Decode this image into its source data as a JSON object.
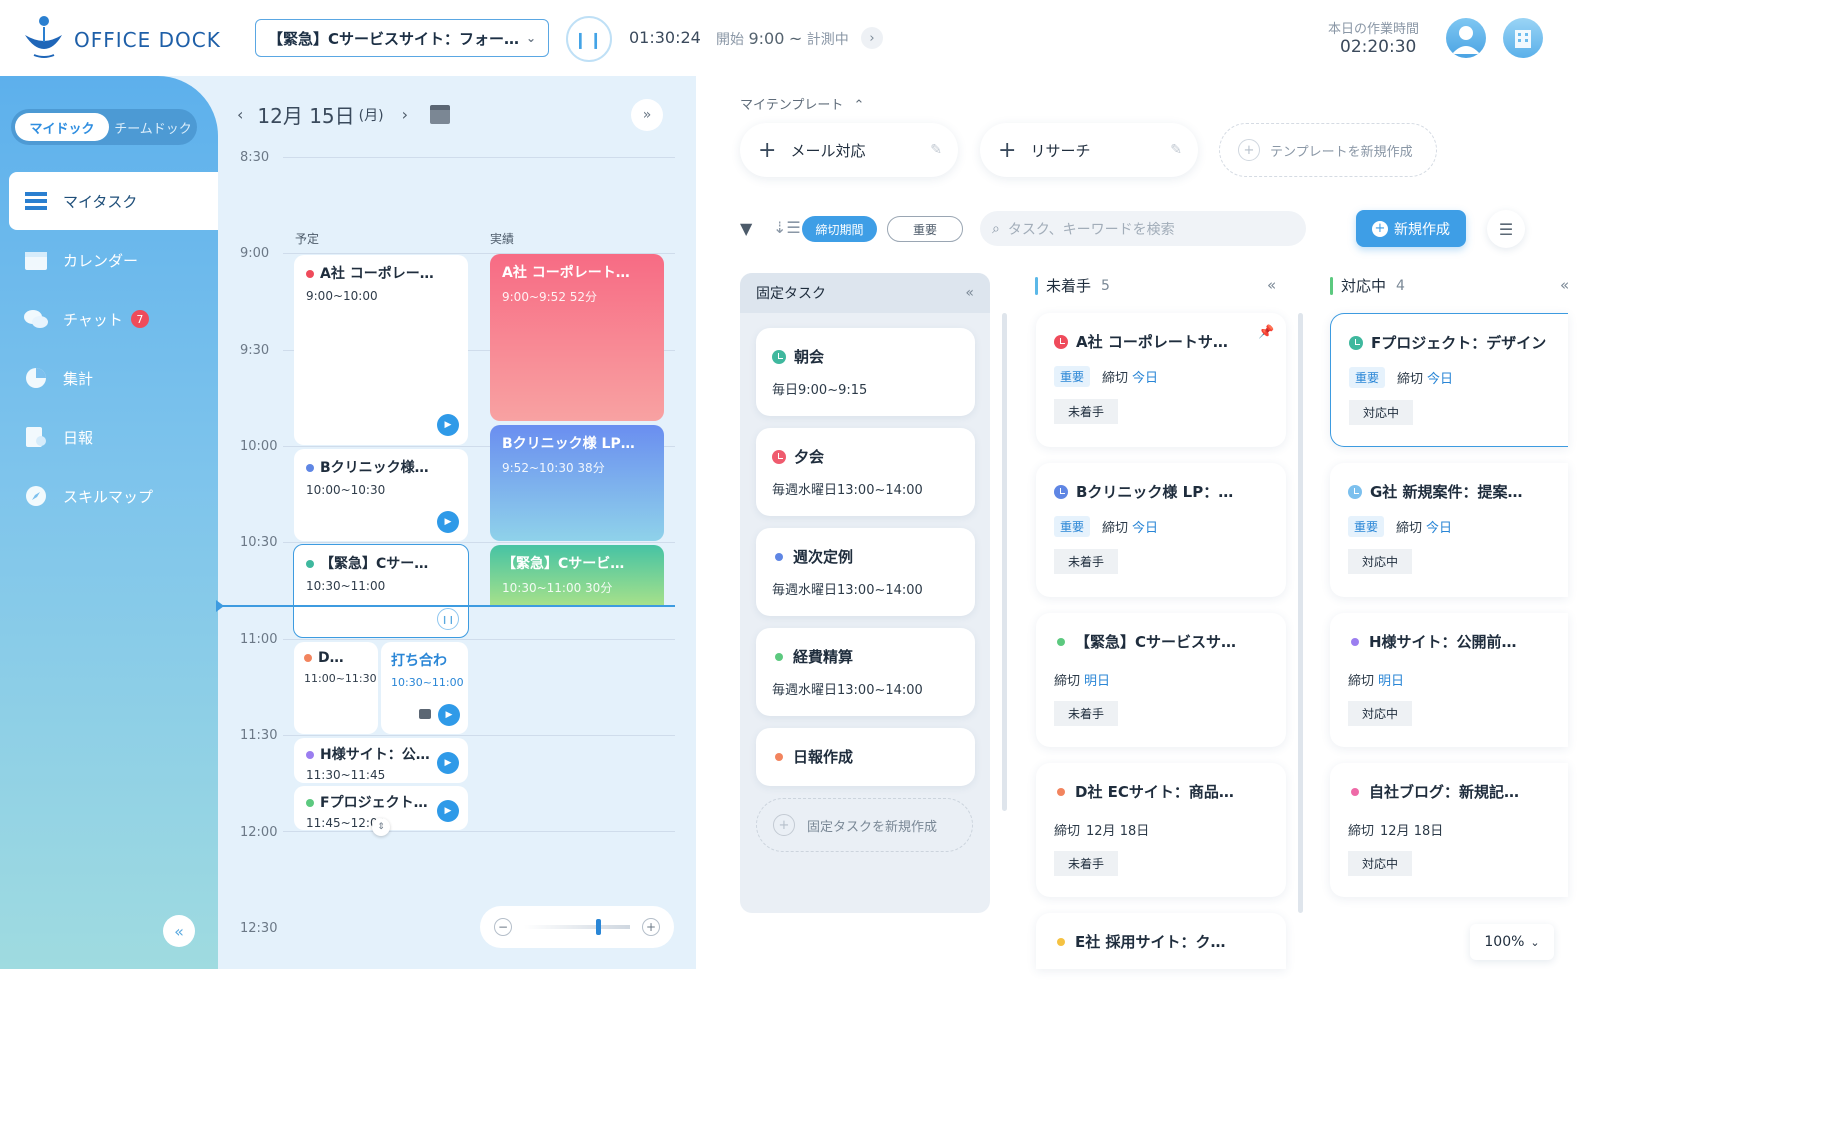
{
  "header": {
    "logo": "OFFICE DOCK",
    "current_task": "【緊急】Cサービスサイト：フォー…",
    "timer": "01:30:24",
    "start_label": "開始",
    "start_time": "9:00",
    "tilde": "~",
    "measuring": "計測中",
    "worktime_label": "本日の作業時間",
    "worktime": "02:20:30"
  },
  "sidebar": {
    "toggle_on": "マイドック",
    "toggle_off": "チームドック",
    "items": [
      {
        "label": "マイタスク",
        "icon": "list-icon"
      },
      {
        "label": "カレンダー",
        "icon": "calendar-icon"
      },
      {
        "label": "チャット",
        "icon": "chat-icon",
        "badge": "7"
      },
      {
        "label": "集計",
        "icon": "pie-chart-icon"
      },
      {
        "label": "日報",
        "icon": "report-icon"
      },
      {
        "label": "スキルマップ",
        "icon": "compass-icon"
      }
    ]
  },
  "calendar": {
    "date": "12月 15日",
    "weekday": "(月)",
    "col_plan": "予定",
    "col_actual": "実績",
    "times": [
      "8:30",
      "9:00",
      "9:30",
      "10:00",
      "10:30",
      "11:00",
      "11:30",
      "12:00",
      "12:30"
    ],
    "plans": [
      {
        "title": "A社 コーポレー…",
        "time": "9:00~10:00",
        "color": "#ef4b5b"
      },
      {
        "title": "Bクリニック様…",
        "time": "10:00~10:30",
        "color": "#5f86e4"
      },
      {
        "title": "【緊急】Cサー…",
        "time": "10:30~11:00",
        "color": "#3fb89e"
      },
      {
        "title": "D…",
        "time": "11:00~11:30",
        "color": "#f2845e"
      },
      {
        "title": "打ち合わ",
        "time": "10:30~11:00",
        "color": "#2a86d6"
      },
      {
        "title": "H様サイト：公…",
        "time": "11:30~11:45",
        "color": "#9b7ef0"
      },
      {
        "title": "Fプロジェクト…",
        "time": "11:45~12:00",
        "color": "#5cc97f"
      }
    ],
    "actuals": [
      {
        "title": "A社 コーポレート…",
        "time": "9:00~9:52",
        "dur": "52分"
      },
      {
        "title": "Bクリニック様 LP…",
        "time": "9:52~10:30",
        "dur": "38分"
      },
      {
        "title": "【緊急】Cサービ…",
        "time": "10:30~11:00",
        "dur": "30分"
      }
    ]
  },
  "templates": {
    "label": "マイテンプレート",
    "items": [
      "メール対応",
      "リサーチ"
    ],
    "new_label": "テンプレートを新規作成"
  },
  "toolbar": {
    "chip_deadline": "締切期間",
    "chip_important": "重要",
    "search_placeholder": "タスク、キーワードを検索",
    "new_button": "新規作成"
  },
  "fixed": {
    "title": "固定タスク",
    "items": [
      {
        "title": "朝会",
        "sub": "毎日9:00~9:15",
        "color": "#3fb89e"
      },
      {
        "title": "夕会",
        "sub": "毎週水曜日13:00~14:00",
        "color": "#ef5b6e"
      },
      {
        "title": "週次定例",
        "sub": "毎週水曜日13:00~14:00",
        "color": "#5f86e4"
      },
      {
        "title": "経費精算",
        "sub": "毎週水曜日13:00~14:00",
        "color": "#5cc97f"
      },
      {
        "title": "日報作成",
        "sub": "",
        "color": "#f2845e"
      }
    ],
    "new_label": "固定タスクを新規作成"
  },
  "columns": [
    {
      "title": "未着手",
      "count": "5",
      "bar_color": "#5bb8e8",
      "cards": [
        {
          "title": "A社 コーポレートサ…",
          "important": "重要",
          "deadline_label": "締切",
          "deadline": "今日",
          "deadline_blue": true,
          "status": "未着手",
          "color": "#ef4b5b",
          "clock": true
        },
        {
          "title": "Bクリニック様 LP：…",
          "important": "重要",
          "deadline_label": "締切",
          "deadline": "今日",
          "deadline_blue": true,
          "status": "未着手",
          "color": "#5f86e4",
          "clock": true
        },
        {
          "title": "【緊急】Cサービスサ…",
          "important": "",
          "deadline_label": "締切",
          "deadline": "明日",
          "deadline_blue": true,
          "status": "未着手",
          "color": "#5cc97f",
          "clock": false
        },
        {
          "title": "D社 ECサイト：商品…",
          "important": "",
          "deadline_label": "締切",
          "deadline": "12月 18日",
          "deadline_blue": false,
          "status": "未着手",
          "color": "#f2845e",
          "clock": false
        },
        {
          "title": "E社 採用サイト：ク…",
          "important": "",
          "deadline_label": "",
          "deadline": "",
          "deadline_blue": false,
          "status": "",
          "color": "#f5c242",
          "clock": false
        }
      ]
    },
    {
      "title": "対応中",
      "count": "4",
      "bar_color": "#5cc97f",
      "cards": [
        {
          "title": "Fプロジェクト：デザイン",
          "important": "重要",
          "deadline_label": "締切",
          "deadline": "今日",
          "deadline_blue": true,
          "status": "対応中",
          "color": "#3fb89e",
          "clock": true
        },
        {
          "title": "G社 新規案件：提案…",
          "important": "重要",
          "deadline_label": "締切",
          "deadline": "今日",
          "deadline_blue": true,
          "status": "対応中",
          "color": "#7cc0ee",
          "clock": true
        },
        {
          "title": "H様サイト：公開前…",
          "important": "",
          "deadline_label": "締切",
          "deadline": "明日",
          "deadline_blue": true,
          "status": "対応中",
          "color": "#9b7ef0",
          "clock": false
        },
        {
          "title": "自社ブログ：新規記…",
          "important": "",
          "deadline_label": "締切",
          "deadline": "12月 18日",
          "deadline_blue": false,
          "status": "対応中",
          "color": "#ee6aa7",
          "clock": false
        }
      ]
    }
  ],
  "zoom": "100%"
}
